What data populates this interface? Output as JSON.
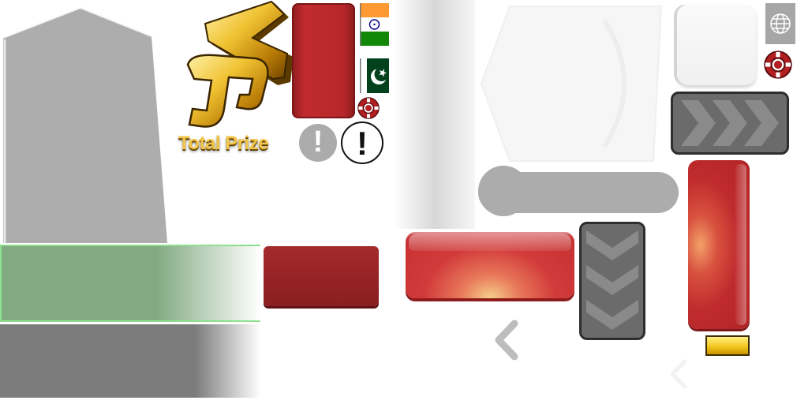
{
  "sprite_sheet": {
    "prize_label": "Total Prize",
    "logo_text": "VS",
    "info_glyph": "!",
    "icons": {
      "chip": "poker-chip-icon",
      "globe": "globe-icon",
      "info": "exclamation-icon",
      "chevron_right": "chevron-right-icon",
      "chevron_down": "chevron-down-icon",
      "chevron_left": "chevron-left-icon"
    },
    "flags": [
      "india-flag",
      "pakistan-flag"
    ],
    "colors": {
      "green_bar": "#82aa82",
      "gray_bar": "#7c7c7c",
      "red": "#c02b2e",
      "dark_red": "#8a1e20",
      "gold": "#f2c64a",
      "chevron_button": "#6b6b6b",
      "pill": "#acacac"
    }
  }
}
